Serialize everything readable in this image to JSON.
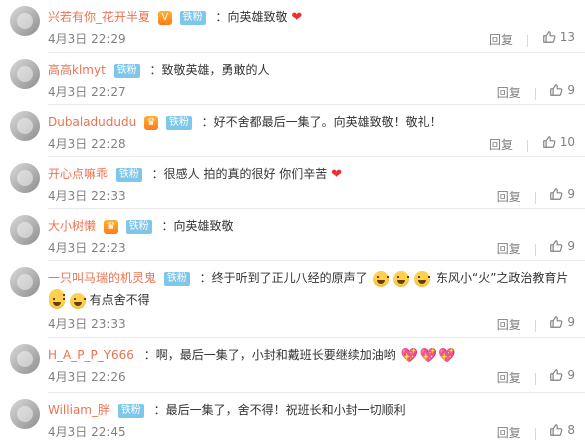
{
  "comments": [
    {
      "name": "兴若有你_花开半夏",
      "verified": true,
      "badge": "铁粉",
      "text": "：向英雄致敬",
      "heart": true,
      "time": "4月3日 22:29",
      "reply_label": "回复",
      "likes": "13"
    },
    {
      "name": "高高klmyt",
      "verified": false,
      "badge": "铁粉",
      "text": "：致敬英雄，勇敢的人",
      "heart": false,
      "time": "4月3日 22:27",
      "reply_label": "回复",
      "likes": "9"
    },
    {
      "name": "Dubaladududu",
      "verified": false,
      "badge": "铁粉",
      "text": "：好不舍都最后一集了。向英雄致敬！敬礼！",
      "heart": false,
      "time": "4月3日 22:28",
      "reply_label": "回复",
      "likes": "10"
    },
    {
      "name": "开心点嘛乖",
      "verified": false,
      "badge": "铁粉",
      "text": "：很感人 拍的真的很好 你们辛苦",
      "heart": true,
      "time": "4月3日 22:33",
      "reply_label": "回复",
      "likes": "9"
    },
    {
      "name": "大小树懒",
      "verified": false,
      "badge": "铁粉",
      "text": "：向英雄致敬",
      "heart": false,
      "time": "4月3日 22:23",
      "reply_label": "回复",
      "likes": "9"
    },
    {
      "name": "一只叫马瑞的机灵鬼",
      "verified": false,
      "badge": "铁粉",
      "text_part1": "：终于听到了正儿八经的原声了",
      "text_part2": "东风小“火”之政治教育片",
      "text_line2": "有点舍不得",
      "time": "4月3日 23:33",
      "reply_label": "回复",
      "likes": "9"
    },
    {
      "name": "H_A_P_P_Y666",
      "verified": false,
      "badge": "",
      "text": "：啊，最后一集了，小封和戴班长要继续加油哟",
      "time": "4月3日 22:26",
      "reply_label": "回复",
      "likes": "9"
    },
    {
      "name": "William_胖",
      "verified": false,
      "badge": "铁粉",
      "text": "：最后一集了，舍不得！祝班长和小封一切顺利",
      "time": "4月3日 22:45",
      "reply_label": "回复",
      "likes": "8"
    }
  ],
  "colors": {
    "name": "#eb7350",
    "badge": "#7ec6ea",
    "meta": "#808080",
    "divider": "#eaeaea"
  }
}
